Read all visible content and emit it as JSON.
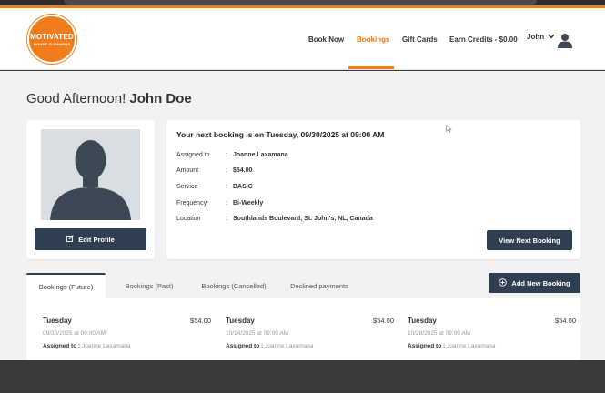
{
  "brand": {
    "name": "MOTIVATED",
    "tagline": "HOUSE CLEANERS",
    "color": "#f07d1a"
  },
  "nav": {
    "items": [
      {
        "label": "Book Now",
        "active": false
      },
      {
        "label": "Bookings",
        "active": true
      },
      {
        "label": "Gift Cards",
        "active": false
      },
      {
        "label": "Earn Credits - $0.00",
        "active": false
      }
    ],
    "user_name": "John"
  },
  "greeting": {
    "prefix": "Good Afternoon!",
    "name": "John Doe"
  },
  "profile": {
    "edit_label": "Edit Profile"
  },
  "next_booking": {
    "title": "Your next booking is on Tuesday, 09/30/2025 at 09:00 AM",
    "details": [
      {
        "key": "Assigned to",
        "value": "Joanne  Laxamana"
      },
      {
        "key": "Amount",
        "value": "$54.00"
      },
      {
        "key": "Service",
        "value": "BASIC"
      },
      {
        "key": "Frequency",
        "value": "Bi-Weekly"
      },
      {
        "key": "Location",
        "value": "Southlands Boulevard, St. John's, NL, Canada"
      }
    ],
    "view_label": "View Next Booking"
  },
  "tabs": [
    {
      "label": "Bookings (Future)",
      "active": true
    },
    {
      "label": "Bookings (Past)",
      "active": false
    },
    {
      "label": "Bookings (Cancelled)",
      "active": false
    },
    {
      "label": "Declined payments",
      "active": false
    }
  ],
  "add_label": "Add New Booking",
  "bookings": [
    {
      "day": "Tuesday",
      "amount": "$54.00",
      "datetime": "09/30/2025 at 09:00 AM",
      "assigned_label": "Assigned to :",
      "assigned_name": "Joanne Laxamana"
    },
    {
      "day": "Tuesday",
      "amount": "$54.00",
      "datetime": "10/14/2025 at 09:00 AM",
      "assigned_label": "Assigned to :",
      "assigned_name": "Joanne Laxamana"
    },
    {
      "day": "Tuesday",
      "amount": "$54.00",
      "datetime": "10/28/2025 at 09:00 AM",
      "assigned_label": "Assigned to :",
      "assigned_name": "Joanne Laxamana"
    }
  ],
  "colors": {
    "accent": "#f07d1a",
    "button_dark": "#2f3e50",
    "background": "#f2f2f2"
  }
}
